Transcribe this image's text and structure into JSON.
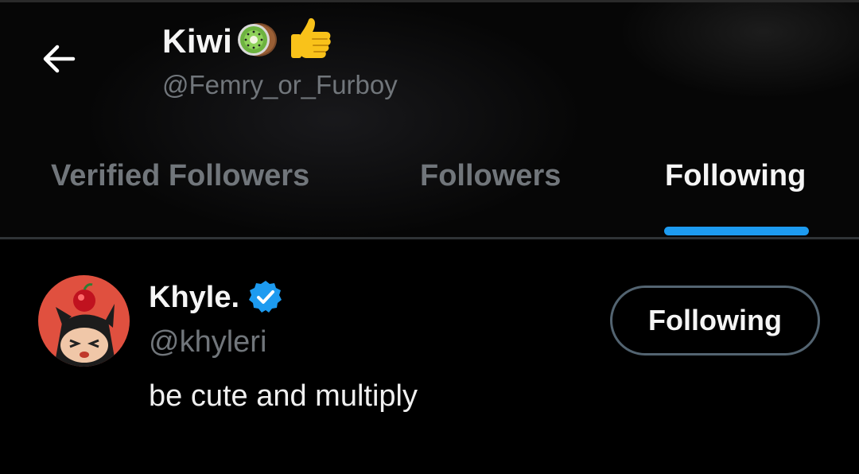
{
  "header": {
    "title": "Kiwi",
    "title_emojis": [
      "kiwi-fruit-icon",
      "thumbs-up-icon"
    ],
    "handle": "@Femry_or_Furboy",
    "back_icon": "arrow-left-icon"
  },
  "tabs": [
    {
      "label": "Verified Followers",
      "active": false
    },
    {
      "label": "Followers",
      "active": false
    },
    {
      "label": "Following",
      "active": true
    }
  ],
  "colors": {
    "accent": "#1d9bf0",
    "background": "#000000",
    "muted_text": "#71767b",
    "primary_text": "#e7e9ea",
    "button_border": "#536471"
  },
  "users": [
    {
      "name": "Khyle.",
      "verified": true,
      "verified_icon": "verified-badge-icon",
      "handle": "@khyleri",
      "bio": "be cute and multiply",
      "button_label": "Following"
    }
  ]
}
